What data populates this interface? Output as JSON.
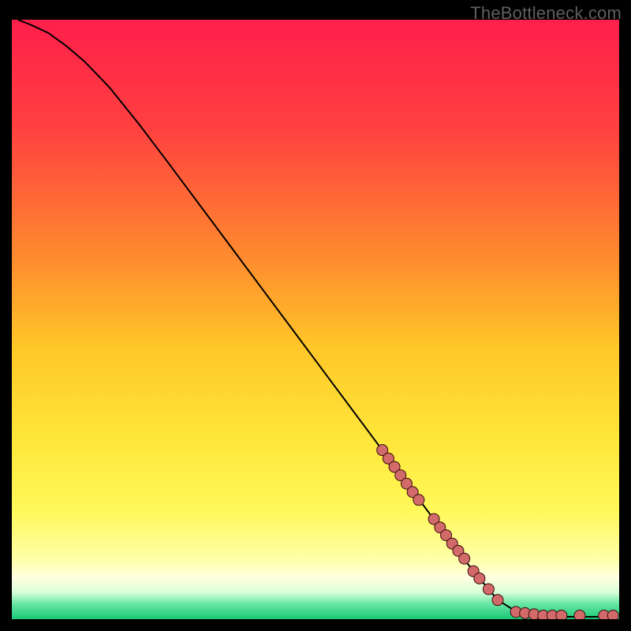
{
  "watermark": "TheBottleneck.com",
  "colors": {
    "background": "#000000",
    "watermark_text": "#5f5f5f",
    "curve_stroke": "#000000",
    "marker_fill": "#d36a6a",
    "marker_stroke": "#3a0d0d"
  },
  "chart_data": {
    "type": "line",
    "title": "",
    "xlabel": "",
    "ylabel": "",
    "xlim": [
      0,
      100
    ],
    "ylim": [
      0,
      100
    ],
    "gradient_stops": [
      {
        "offset": 0.0,
        "color": "#ff1f4b"
      },
      {
        "offset": 0.18,
        "color": "#ff4040"
      },
      {
        "offset": 0.4,
        "color": "#ff8c2e"
      },
      {
        "offset": 0.55,
        "color": "#ffc828"
      },
      {
        "offset": 0.7,
        "color": "#ffe63a"
      },
      {
        "offset": 0.82,
        "color": "#fff95a"
      },
      {
        "offset": 0.9,
        "color": "#ffffa8"
      },
      {
        "offset": 0.93,
        "color": "#ffffe0"
      },
      {
        "offset": 0.955,
        "color": "#d9ffd9"
      },
      {
        "offset": 0.975,
        "color": "#66e6a3"
      },
      {
        "offset": 1.0,
        "color": "#18c977"
      }
    ],
    "curve_points": [
      {
        "x": 1.0,
        "y": 100.0
      },
      {
        "x": 3.0,
        "y": 99.2
      },
      {
        "x": 6.0,
        "y": 97.8
      },
      {
        "x": 9.0,
        "y": 95.6
      },
      {
        "x": 12.0,
        "y": 93.0
      },
      {
        "x": 16.0,
        "y": 88.8
      },
      {
        "x": 21.0,
        "y": 82.5
      },
      {
        "x": 26.0,
        "y": 75.8
      },
      {
        "x": 31.0,
        "y": 69.0
      },
      {
        "x": 36.0,
        "y": 62.2
      },
      {
        "x": 41.0,
        "y": 55.4
      },
      {
        "x": 46.0,
        "y": 48.6
      },
      {
        "x": 51.0,
        "y": 41.8
      },
      {
        "x": 56.0,
        "y": 35.0
      },
      {
        "x": 61.0,
        "y": 28.2
      },
      {
        "x": 66.0,
        "y": 21.4
      },
      {
        "x": 71.0,
        "y": 14.6
      },
      {
        "x": 76.0,
        "y": 8.0
      },
      {
        "x": 80.0,
        "y": 3.2
      },
      {
        "x": 83.0,
        "y": 1.3
      },
      {
        "x": 86.0,
        "y": 0.6
      },
      {
        "x": 90.0,
        "y": 0.4
      },
      {
        "x": 95.0,
        "y": 0.4
      },
      {
        "x": 99.0,
        "y": 0.4
      }
    ],
    "series": [
      {
        "name": "highlighted-points",
        "marker_radius": 7,
        "points": [
          {
            "x": 61.0,
            "y": 28.2
          },
          {
            "x": 62.0,
            "y": 26.8
          },
          {
            "x": 63.0,
            "y": 25.4
          },
          {
            "x": 64.0,
            "y": 24.0
          },
          {
            "x": 65.0,
            "y": 22.6
          },
          {
            "x": 66.0,
            "y": 21.2
          },
          {
            "x": 67.0,
            "y": 19.9
          },
          {
            "x": 69.5,
            "y": 16.7
          },
          {
            "x": 70.5,
            "y": 15.3
          },
          {
            "x": 71.5,
            "y": 14.0
          },
          {
            "x": 72.5,
            "y": 12.6
          },
          {
            "x": 73.5,
            "y": 11.4
          },
          {
            "x": 74.5,
            "y": 10.1
          },
          {
            "x": 76.0,
            "y": 8.0
          },
          {
            "x": 77.0,
            "y": 6.8
          },
          {
            "x": 78.5,
            "y": 5.0
          },
          {
            "x": 80.0,
            "y": 3.2
          },
          {
            "x": 83.0,
            "y": 1.2
          },
          {
            "x": 84.5,
            "y": 1.0
          },
          {
            "x": 86.0,
            "y": 0.8
          },
          {
            "x": 87.5,
            "y": 0.6
          },
          {
            "x": 89.0,
            "y": 0.6
          },
          {
            "x": 90.5,
            "y": 0.6
          },
          {
            "x": 93.5,
            "y": 0.6
          },
          {
            "x": 97.5,
            "y": 0.6
          },
          {
            "x": 99.0,
            "y": 0.6
          }
        ]
      }
    ]
  }
}
